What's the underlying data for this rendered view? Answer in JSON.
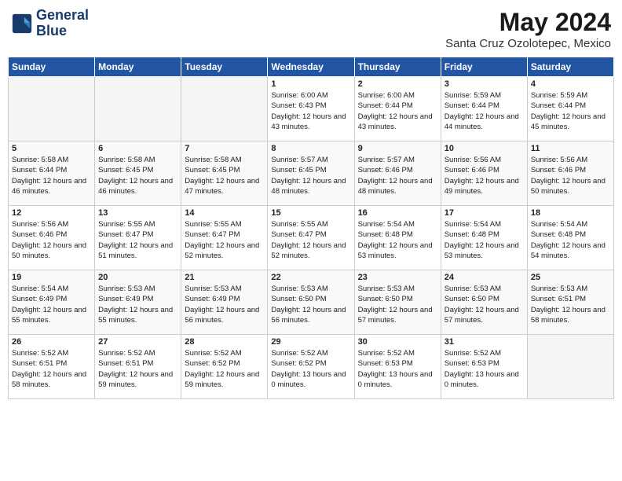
{
  "header": {
    "logo_line1": "General",
    "logo_line2": "Blue",
    "month": "May 2024",
    "location": "Santa Cruz Ozolotepec, Mexico"
  },
  "weekdays": [
    "Sunday",
    "Monday",
    "Tuesday",
    "Wednesday",
    "Thursday",
    "Friday",
    "Saturday"
  ],
  "weeks": [
    [
      {
        "day": "",
        "empty": true
      },
      {
        "day": "",
        "empty": true
      },
      {
        "day": "",
        "empty": true
      },
      {
        "day": "1",
        "sunrise": "6:00 AM",
        "sunset": "6:43 PM",
        "daylight": "12 hours and 43 minutes."
      },
      {
        "day": "2",
        "sunrise": "6:00 AM",
        "sunset": "6:44 PM",
        "daylight": "12 hours and 43 minutes."
      },
      {
        "day": "3",
        "sunrise": "5:59 AM",
        "sunset": "6:44 PM",
        "daylight": "12 hours and 44 minutes."
      },
      {
        "day": "4",
        "sunrise": "5:59 AM",
        "sunset": "6:44 PM",
        "daylight": "12 hours and 45 minutes."
      }
    ],
    [
      {
        "day": "5",
        "sunrise": "5:58 AM",
        "sunset": "6:44 PM",
        "daylight": "12 hours and 46 minutes."
      },
      {
        "day": "6",
        "sunrise": "5:58 AM",
        "sunset": "6:45 PM",
        "daylight": "12 hours and 46 minutes."
      },
      {
        "day": "7",
        "sunrise": "5:58 AM",
        "sunset": "6:45 PM",
        "daylight": "12 hours and 47 minutes."
      },
      {
        "day": "8",
        "sunrise": "5:57 AM",
        "sunset": "6:45 PM",
        "daylight": "12 hours and 48 minutes."
      },
      {
        "day": "9",
        "sunrise": "5:57 AM",
        "sunset": "6:46 PM",
        "daylight": "12 hours and 48 minutes."
      },
      {
        "day": "10",
        "sunrise": "5:56 AM",
        "sunset": "6:46 PM",
        "daylight": "12 hours and 49 minutes."
      },
      {
        "day": "11",
        "sunrise": "5:56 AM",
        "sunset": "6:46 PM",
        "daylight": "12 hours and 50 minutes."
      }
    ],
    [
      {
        "day": "12",
        "sunrise": "5:56 AM",
        "sunset": "6:46 PM",
        "daylight": "12 hours and 50 minutes."
      },
      {
        "day": "13",
        "sunrise": "5:55 AM",
        "sunset": "6:47 PM",
        "daylight": "12 hours and 51 minutes."
      },
      {
        "day": "14",
        "sunrise": "5:55 AM",
        "sunset": "6:47 PM",
        "daylight": "12 hours and 52 minutes."
      },
      {
        "day": "15",
        "sunrise": "5:55 AM",
        "sunset": "6:47 PM",
        "daylight": "12 hours and 52 minutes."
      },
      {
        "day": "16",
        "sunrise": "5:54 AM",
        "sunset": "6:48 PM",
        "daylight": "12 hours and 53 minutes."
      },
      {
        "day": "17",
        "sunrise": "5:54 AM",
        "sunset": "6:48 PM",
        "daylight": "12 hours and 53 minutes."
      },
      {
        "day": "18",
        "sunrise": "5:54 AM",
        "sunset": "6:48 PM",
        "daylight": "12 hours and 54 minutes."
      }
    ],
    [
      {
        "day": "19",
        "sunrise": "5:54 AM",
        "sunset": "6:49 PM",
        "daylight": "12 hours and 55 minutes."
      },
      {
        "day": "20",
        "sunrise": "5:53 AM",
        "sunset": "6:49 PM",
        "daylight": "12 hours and 55 minutes."
      },
      {
        "day": "21",
        "sunrise": "5:53 AM",
        "sunset": "6:49 PM",
        "daylight": "12 hours and 56 minutes."
      },
      {
        "day": "22",
        "sunrise": "5:53 AM",
        "sunset": "6:50 PM",
        "daylight": "12 hours and 56 minutes."
      },
      {
        "day": "23",
        "sunrise": "5:53 AM",
        "sunset": "6:50 PM",
        "daylight": "12 hours and 57 minutes."
      },
      {
        "day": "24",
        "sunrise": "5:53 AM",
        "sunset": "6:50 PM",
        "daylight": "12 hours and 57 minutes."
      },
      {
        "day": "25",
        "sunrise": "5:53 AM",
        "sunset": "6:51 PM",
        "daylight": "12 hours and 58 minutes."
      }
    ],
    [
      {
        "day": "26",
        "sunrise": "5:52 AM",
        "sunset": "6:51 PM",
        "daylight": "12 hours and 58 minutes."
      },
      {
        "day": "27",
        "sunrise": "5:52 AM",
        "sunset": "6:51 PM",
        "daylight": "12 hours and 59 minutes."
      },
      {
        "day": "28",
        "sunrise": "5:52 AM",
        "sunset": "6:52 PM",
        "daylight": "12 hours and 59 minutes."
      },
      {
        "day": "29",
        "sunrise": "5:52 AM",
        "sunset": "6:52 PM",
        "daylight": "13 hours and 0 minutes."
      },
      {
        "day": "30",
        "sunrise": "5:52 AM",
        "sunset": "6:53 PM",
        "daylight": "13 hours and 0 minutes."
      },
      {
        "day": "31",
        "sunrise": "5:52 AM",
        "sunset": "6:53 PM",
        "daylight": "13 hours and 0 minutes."
      },
      {
        "day": "",
        "empty": true
      }
    ]
  ]
}
